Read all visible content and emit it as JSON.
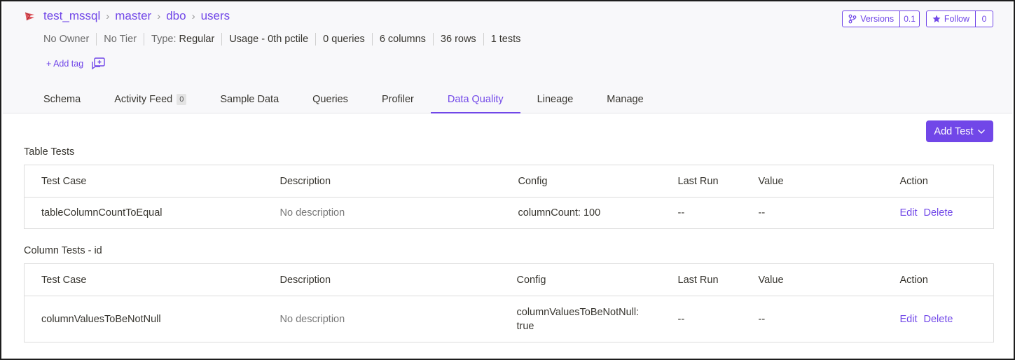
{
  "breadcrumb": [
    "test_mssql",
    "master",
    "dbo",
    "users"
  ],
  "meta": {
    "owner": "No Owner",
    "tier": "No Tier",
    "type_label": "Type:",
    "type_value": "Regular",
    "usage": "Usage - 0th pctile",
    "queries": "0 queries",
    "columns": "6 columns",
    "rows": "36 rows",
    "tests": "1 tests"
  },
  "add_tag": "+ Add tag",
  "versions": {
    "label": "Versions",
    "count": "0.1"
  },
  "follow": {
    "label": "Follow",
    "count": "0"
  },
  "tabs": [
    {
      "label": "Schema"
    },
    {
      "label": "Activity Feed",
      "badge": "0"
    },
    {
      "label": "Sample Data"
    },
    {
      "label": "Queries"
    },
    {
      "label": "Profiler"
    },
    {
      "label": "Data Quality",
      "active": true
    },
    {
      "label": "Lineage"
    },
    {
      "label": "Manage"
    }
  ],
  "add_test_label": "Add Test",
  "table_tests": {
    "title": "Table Tests",
    "headers": [
      "Test Case",
      "Description",
      "Config",
      "Last Run",
      "Value",
      "Action"
    ],
    "rows": [
      {
        "test_case": "tableColumnCountToEqual",
        "description": "No description",
        "config": "columnCount: 100",
        "last_run": "--",
        "value": "--",
        "edit": "Edit",
        "delete": "Delete"
      }
    ]
  },
  "column_tests": {
    "title": "Column Tests - id",
    "headers": [
      "Test Case",
      "Description",
      "Config",
      "Last Run",
      "Value",
      "Action"
    ],
    "rows": [
      {
        "test_case": "columnValuesToBeNotNull",
        "description": "No description",
        "config": "columnValuesToBeNotNull: true",
        "last_run": "--",
        "value": "--",
        "edit": "Edit",
        "delete": "Delete"
      }
    ]
  },
  "colors": {
    "accent": "#7147e8",
    "text": "#37352f",
    "muted": "#777777"
  }
}
